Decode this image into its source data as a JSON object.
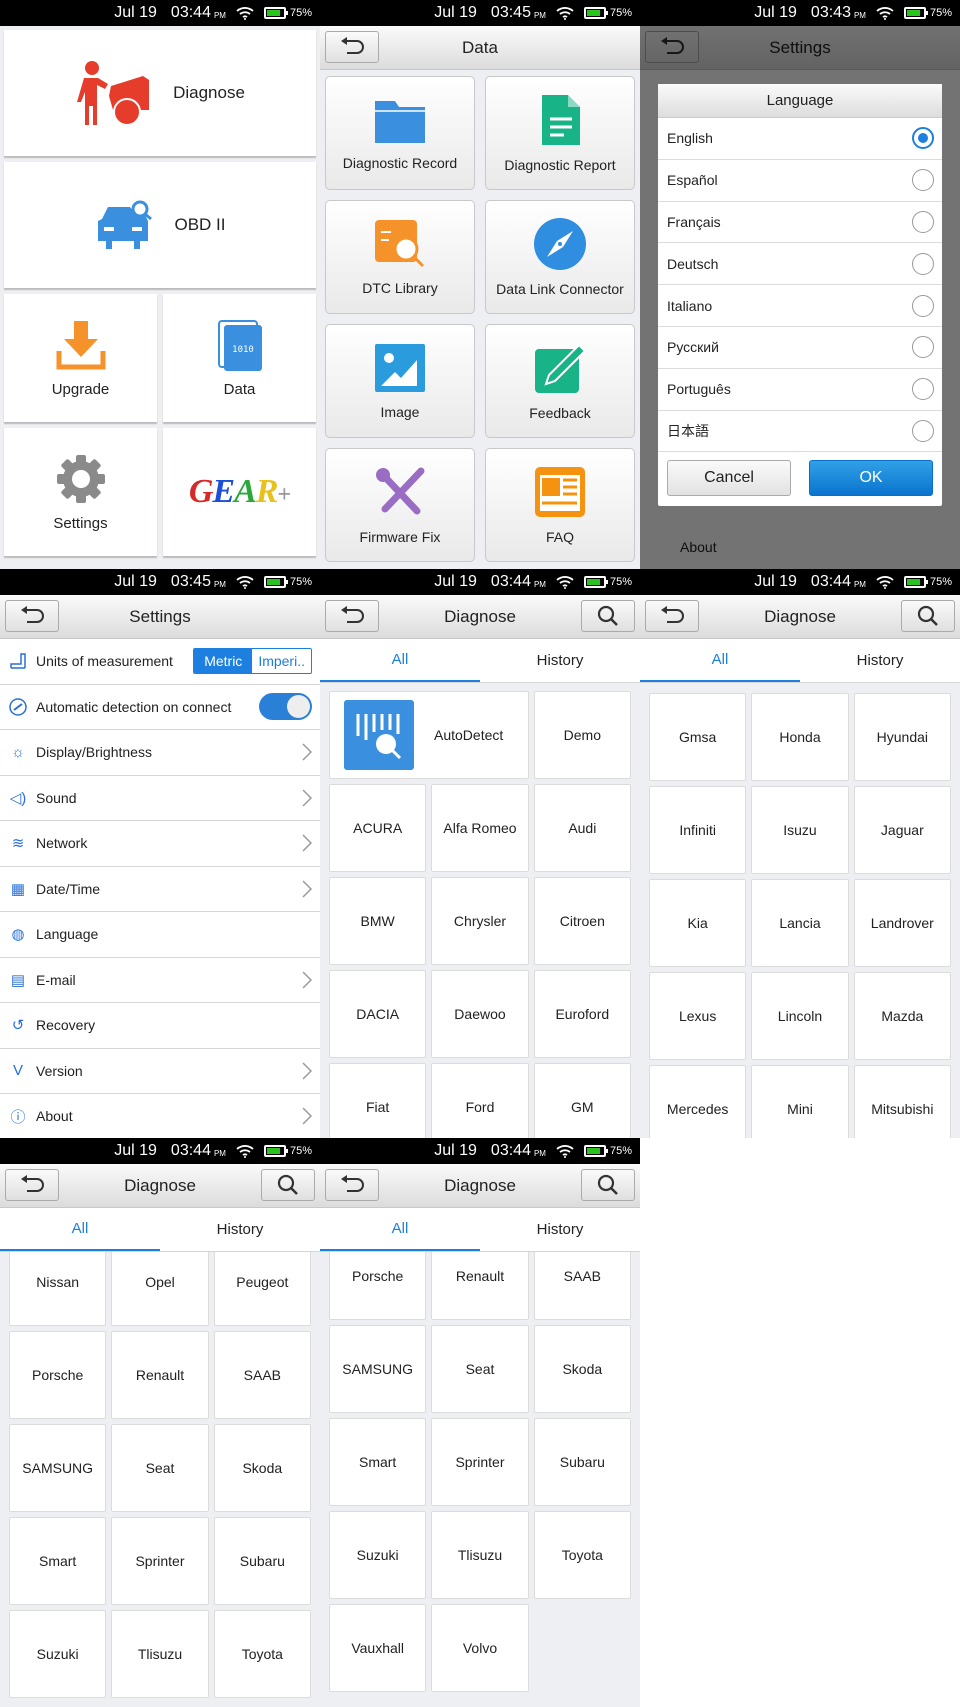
{
  "status_bars": [
    {
      "date": "Jul 19",
      "time": "03:44",
      "ampm": "PM",
      "battery": "75%"
    },
    {
      "date": "Jul 19",
      "time": "03:45",
      "ampm": "PM",
      "battery": "75%"
    },
    {
      "date": "Jul 19",
      "time": "03:43",
      "ampm": "PM",
      "battery": "75%"
    },
    {
      "date": "Jul 19",
      "time": "03:45",
      "ampm": "PM",
      "battery": "75%"
    },
    {
      "date": "Jul 19",
      "time": "03:44",
      "ampm": "PM",
      "battery": "75%"
    },
    {
      "date": "Jul 19",
      "time": "03:44",
      "ampm": "PM",
      "battery": "75%"
    },
    {
      "date": "Jul 19",
      "time": "03:44",
      "ampm": "PM",
      "battery": "75%"
    },
    {
      "date": "Jul 19",
      "time": "03:44",
      "ampm": "PM",
      "battery": "75%"
    }
  ],
  "home": {
    "diagnose": "Diagnose",
    "obd": "OBD II",
    "upgrade": "Upgrade",
    "data": "Data",
    "settings": "Settings",
    "gear": "GEAR+"
  },
  "data_screen": {
    "title": "Data",
    "items": [
      "Diagnostic Record",
      "Diagnostic Report",
      "DTC Library",
      "Data Link Connector",
      "Image",
      "Feedback",
      "Firmware Fix",
      "FAQ"
    ]
  },
  "language_dialog": {
    "bg_title": "Settings",
    "title": "Language",
    "options": [
      "English",
      "Español",
      "Français",
      "Deutsch",
      "Italiano",
      "Русский",
      "Português",
      "日本語"
    ],
    "selected": "English",
    "cancel": "Cancel",
    "ok": "OK",
    "bg_about": "About"
  },
  "settings": {
    "title": "Settings",
    "units_label": "Units of measurement",
    "units_options": [
      "Metric",
      "Imperi.."
    ],
    "units_selected": "Metric",
    "auto_detect_label": "Automatic detection on connect",
    "auto_detect_on": true,
    "items": [
      "Display/Brightness",
      "Sound",
      "Network",
      "Date/Time",
      "Language",
      "E-mail",
      "Recovery",
      "Version",
      "About"
    ]
  },
  "diagnose": {
    "title": "Diagnose",
    "tabs": [
      "All",
      "History"
    ],
    "active_tab": "All",
    "autodetect": "AutoDetect",
    "demo": "Demo",
    "page1": [
      "ACURA",
      "Alfa Romeo",
      "Audi",
      "BMW",
      "Chrysler",
      "Citroen",
      "DACIA",
      "Daewoo",
      "Euroford",
      "Fiat",
      "Ford",
      "GM"
    ],
    "page2": [
      "Gmsa",
      "Honda",
      "Hyundai",
      "Infiniti",
      "Isuzu",
      "Jaguar",
      "Kia",
      "Lancia",
      "Landrover",
      "Lexus",
      "Lincoln",
      "Mazda",
      "Mercedes",
      "Mini",
      "Mitsubishi"
    ],
    "page3": [
      "Nissan",
      "Opel",
      "Peugeot",
      "Porsche",
      "Renault",
      "SAAB",
      "SAMSUNG",
      "Seat",
      "Skoda",
      "Smart",
      "Sprinter",
      "Subaru",
      "Suzuki",
      "Tlisuzu",
      "Toyota"
    ],
    "page4": [
      "Porsche",
      "Renault",
      "SAAB",
      "SAMSUNG",
      "Seat",
      "Skoda",
      "Smart",
      "Sprinter",
      "Subaru",
      "Suzuki",
      "Tlisuzu",
      "Toyota",
      "Vauxhall",
      "Volvo"
    ]
  },
  "colors": {
    "accent": "#1d7fe0",
    "diagnose_red": "#e53c2b",
    "obd_blue": "#3a8fde",
    "upgrade_orange": "#f5922a",
    "battery_green": "#29c21f"
  }
}
